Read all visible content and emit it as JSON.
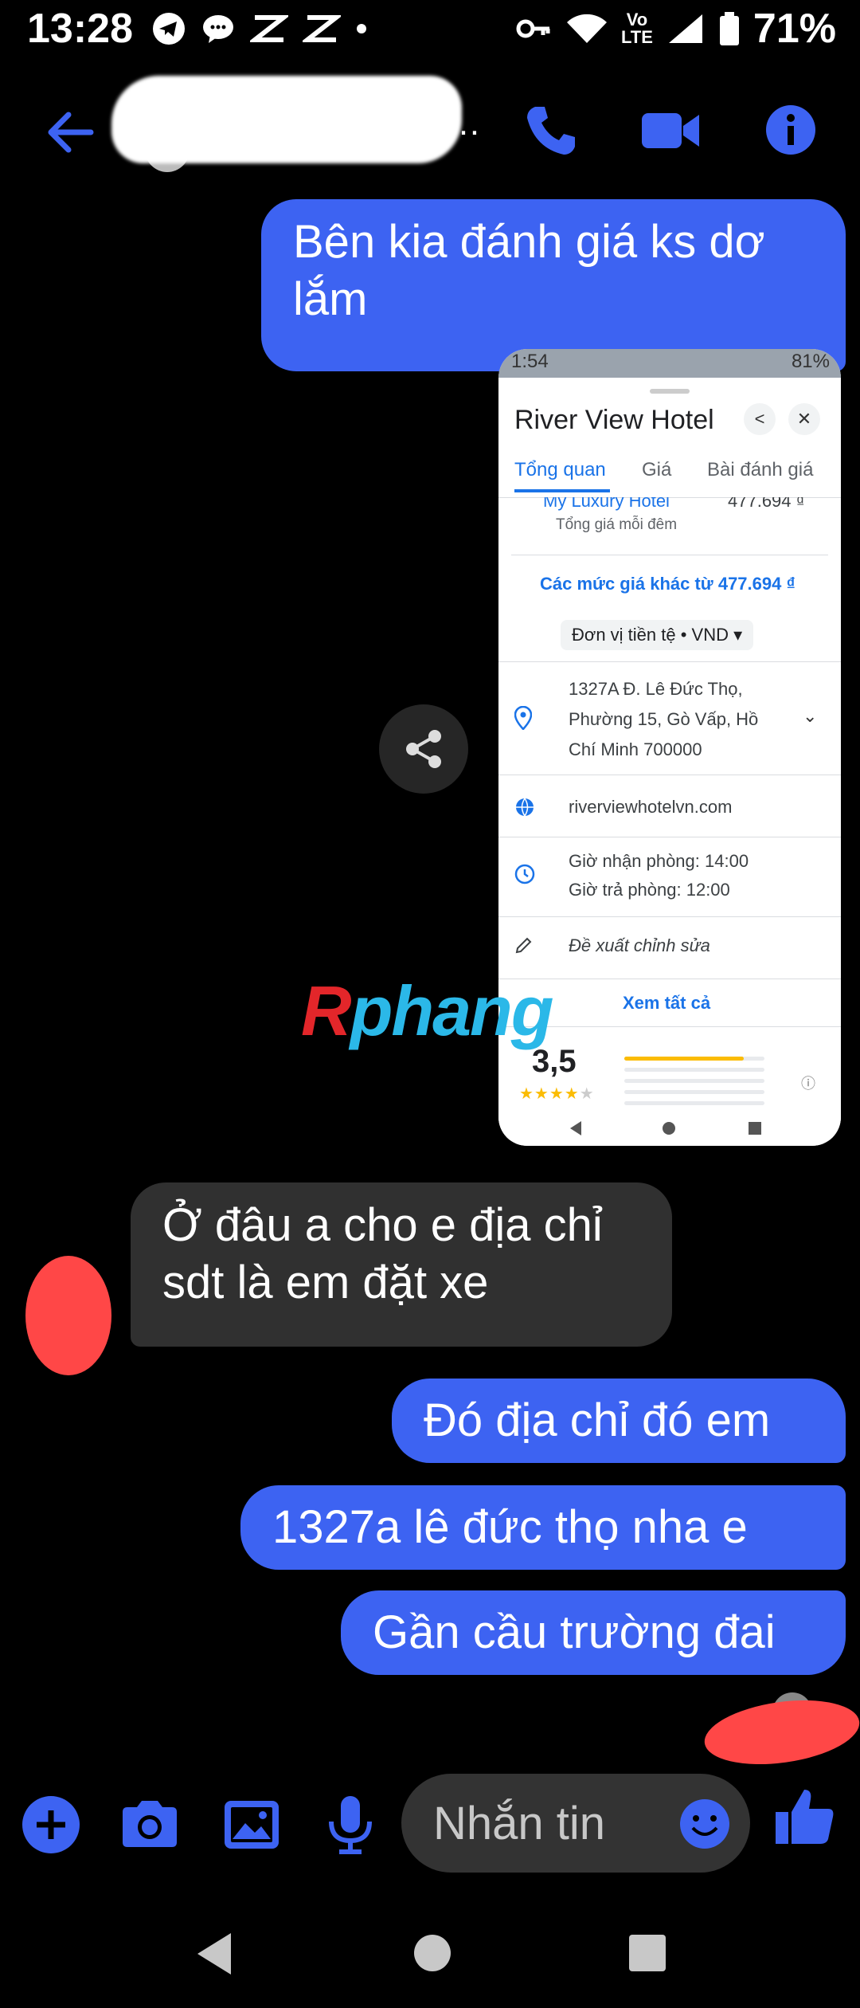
{
  "status_bar": {
    "time": "13:28",
    "battery": "71%",
    "network": "Vo LTE",
    "icons": [
      "telegram-icon",
      "chat-bubble-icon",
      "capcut-icon",
      "capcut-icon",
      "dot-icon",
      "key-icon",
      "wifi-icon",
      "volte-icon",
      "signal-icon",
      "battery-icon"
    ]
  },
  "header": {
    "back_icon": "back-arrow-icon",
    "contact_name_redacted": "…",
    "call_icon": "phone-icon",
    "video_icon": "video-camera-icon",
    "info_icon": "info-icon",
    "accent_color": "#3d63f2"
  },
  "messages": [
    {
      "type": "sent",
      "text_lines": [
        "Bên kia đánh giá ks dơ",
        "lắm"
      ]
    },
    {
      "type": "image",
      "caption": ""
    },
    {
      "type": "received",
      "text_lines": [
        "Ở đâu a cho e địa chỉ",
        "sdt là em đặt xe"
      ]
    },
    {
      "type": "sent",
      "text_lines": [
        "Đó địa chỉ đó em"
      ]
    },
    {
      "type": "sent",
      "text_lines": [
        "1327a lê đức  thọ nha e"
      ]
    },
    {
      "type": "sent",
      "text_lines": [
        "Gần cầu trường đai"
      ]
    }
  ],
  "embedded_screenshot": {
    "status_time": "1:54",
    "status_battery": "81%",
    "title": "River View Hotel",
    "tabs": [
      "Tổng quan",
      "Giá",
      "Bài đánh giá"
    ],
    "partial_row": {
      "name": "My Luxury Hotel",
      "price": "477.694 ₫",
      "note": "Tổng giá mỗi đêm"
    },
    "other_prices_link": "Các mức giá khác từ 477.694 ₫",
    "currency_chip": "Đơn vị tiền tệ  •  VND",
    "address_lines": [
      "1327A Đ. Lê Đức Thọ,",
      "Phường 15, Gò Vấp, Hồ",
      "Chí Minh 700000"
    ],
    "website": "riverviewhotelvn.com",
    "checkin": "Giờ nhận phòng: 14:00",
    "checkout": "Giờ trả phòng: 12:00",
    "suggest_edit": "Đề xuất chỉnh sửa",
    "see_all": "Xem tất cả",
    "rating": "3,5",
    "rating_stars": 3.5,
    "rating_bar_top_fraction": 0.85
  },
  "watermark": {
    "first_letter": "R",
    "rest": "phang"
  },
  "composer": {
    "placeholder": "Nhắn tin",
    "icons": [
      "plus-icon",
      "camera-icon",
      "gallery-icon",
      "microphone-icon",
      "emoji-icon",
      "thumbs-up-icon"
    ]
  },
  "navbar": {
    "icons": [
      "back-triangle-icon",
      "home-circle-icon",
      "recents-square-icon"
    ]
  }
}
